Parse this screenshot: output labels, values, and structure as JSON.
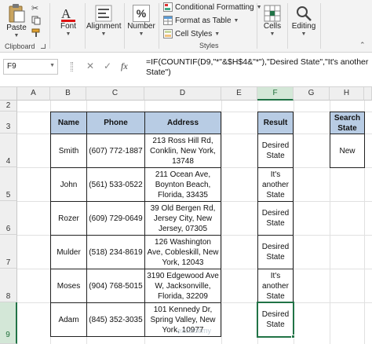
{
  "ribbon": {
    "paste_label": "Paste",
    "clipboard_label": "Clipboard",
    "font_label": "Font",
    "alignment_label": "Alignment",
    "number_label": "Number",
    "percent_glyph": "%",
    "conditional_formatting_label": "Conditional Formatting",
    "format_as_table_label": "Format as Table",
    "cell_styles_label": "Cell Styles",
    "styles_label": "Styles",
    "cells_label": "Cells",
    "editing_label": "Editing"
  },
  "formula_bar": {
    "name_box": "F9",
    "cancel_glyph": "✕",
    "enter_glyph": "✓",
    "fx_label": "fx",
    "formula": "=IF(COUNTIF(D9,\"*\"&$H$4&\"*\"),\"Desired State\",\"It's another State\")"
  },
  "grid": {
    "columns": [
      "A",
      "B",
      "C",
      "D",
      "E",
      "F",
      "G",
      "H"
    ],
    "selected_column": "F",
    "rows": [
      "2",
      "3",
      "4",
      "5",
      "6",
      "7",
      "8",
      "9"
    ],
    "selected_row": "9"
  },
  "table": {
    "headers": {
      "name": "Name",
      "phone": "Phone",
      "address": "Address"
    },
    "rows": [
      {
        "name": "Smith",
        "phone": "(607) 772-1887",
        "address": "213 Ross Hill Rd, Conklin, New York, 13748"
      },
      {
        "name": "John",
        "phone": "(561) 533-0522",
        "address": "211 Ocean Ave, Boynton Beach, Florida, 33435"
      },
      {
        "name": "Rozer",
        "phone": "(609) 729-0649",
        "address": "39 Old Bergen Rd, Jersey City, New Jersey, 07305"
      },
      {
        "name": "Mulder",
        "phone": "(518) 234-8619",
        "address": "126 Washington Ave, Cobleskill, New York, 12043"
      },
      {
        "name": "Moses",
        "phone": "(904) 768-5015",
        "address": "3190 Edgewood Ave W, Jacksonville, Florida, 32209"
      },
      {
        "name": "Adam",
        "phone": "(845) 352-3035",
        "address": "101 Kennedy Dr, Spring Valley, New York, 10977"
      }
    ]
  },
  "result": {
    "header": "Result",
    "values": [
      "Desired State",
      "It's another State",
      "Desired State",
      "Desired State",
      "It's another State",
      "Desired State"
    ]
  },
  "search": {
    "header": "Search State",
    "value": "New"
  },
  "watermark": "exceldemy",
  "colors": {
    "excel_green": "#217346",
    "table_header_fill": "#b8cce4"
  }
}
